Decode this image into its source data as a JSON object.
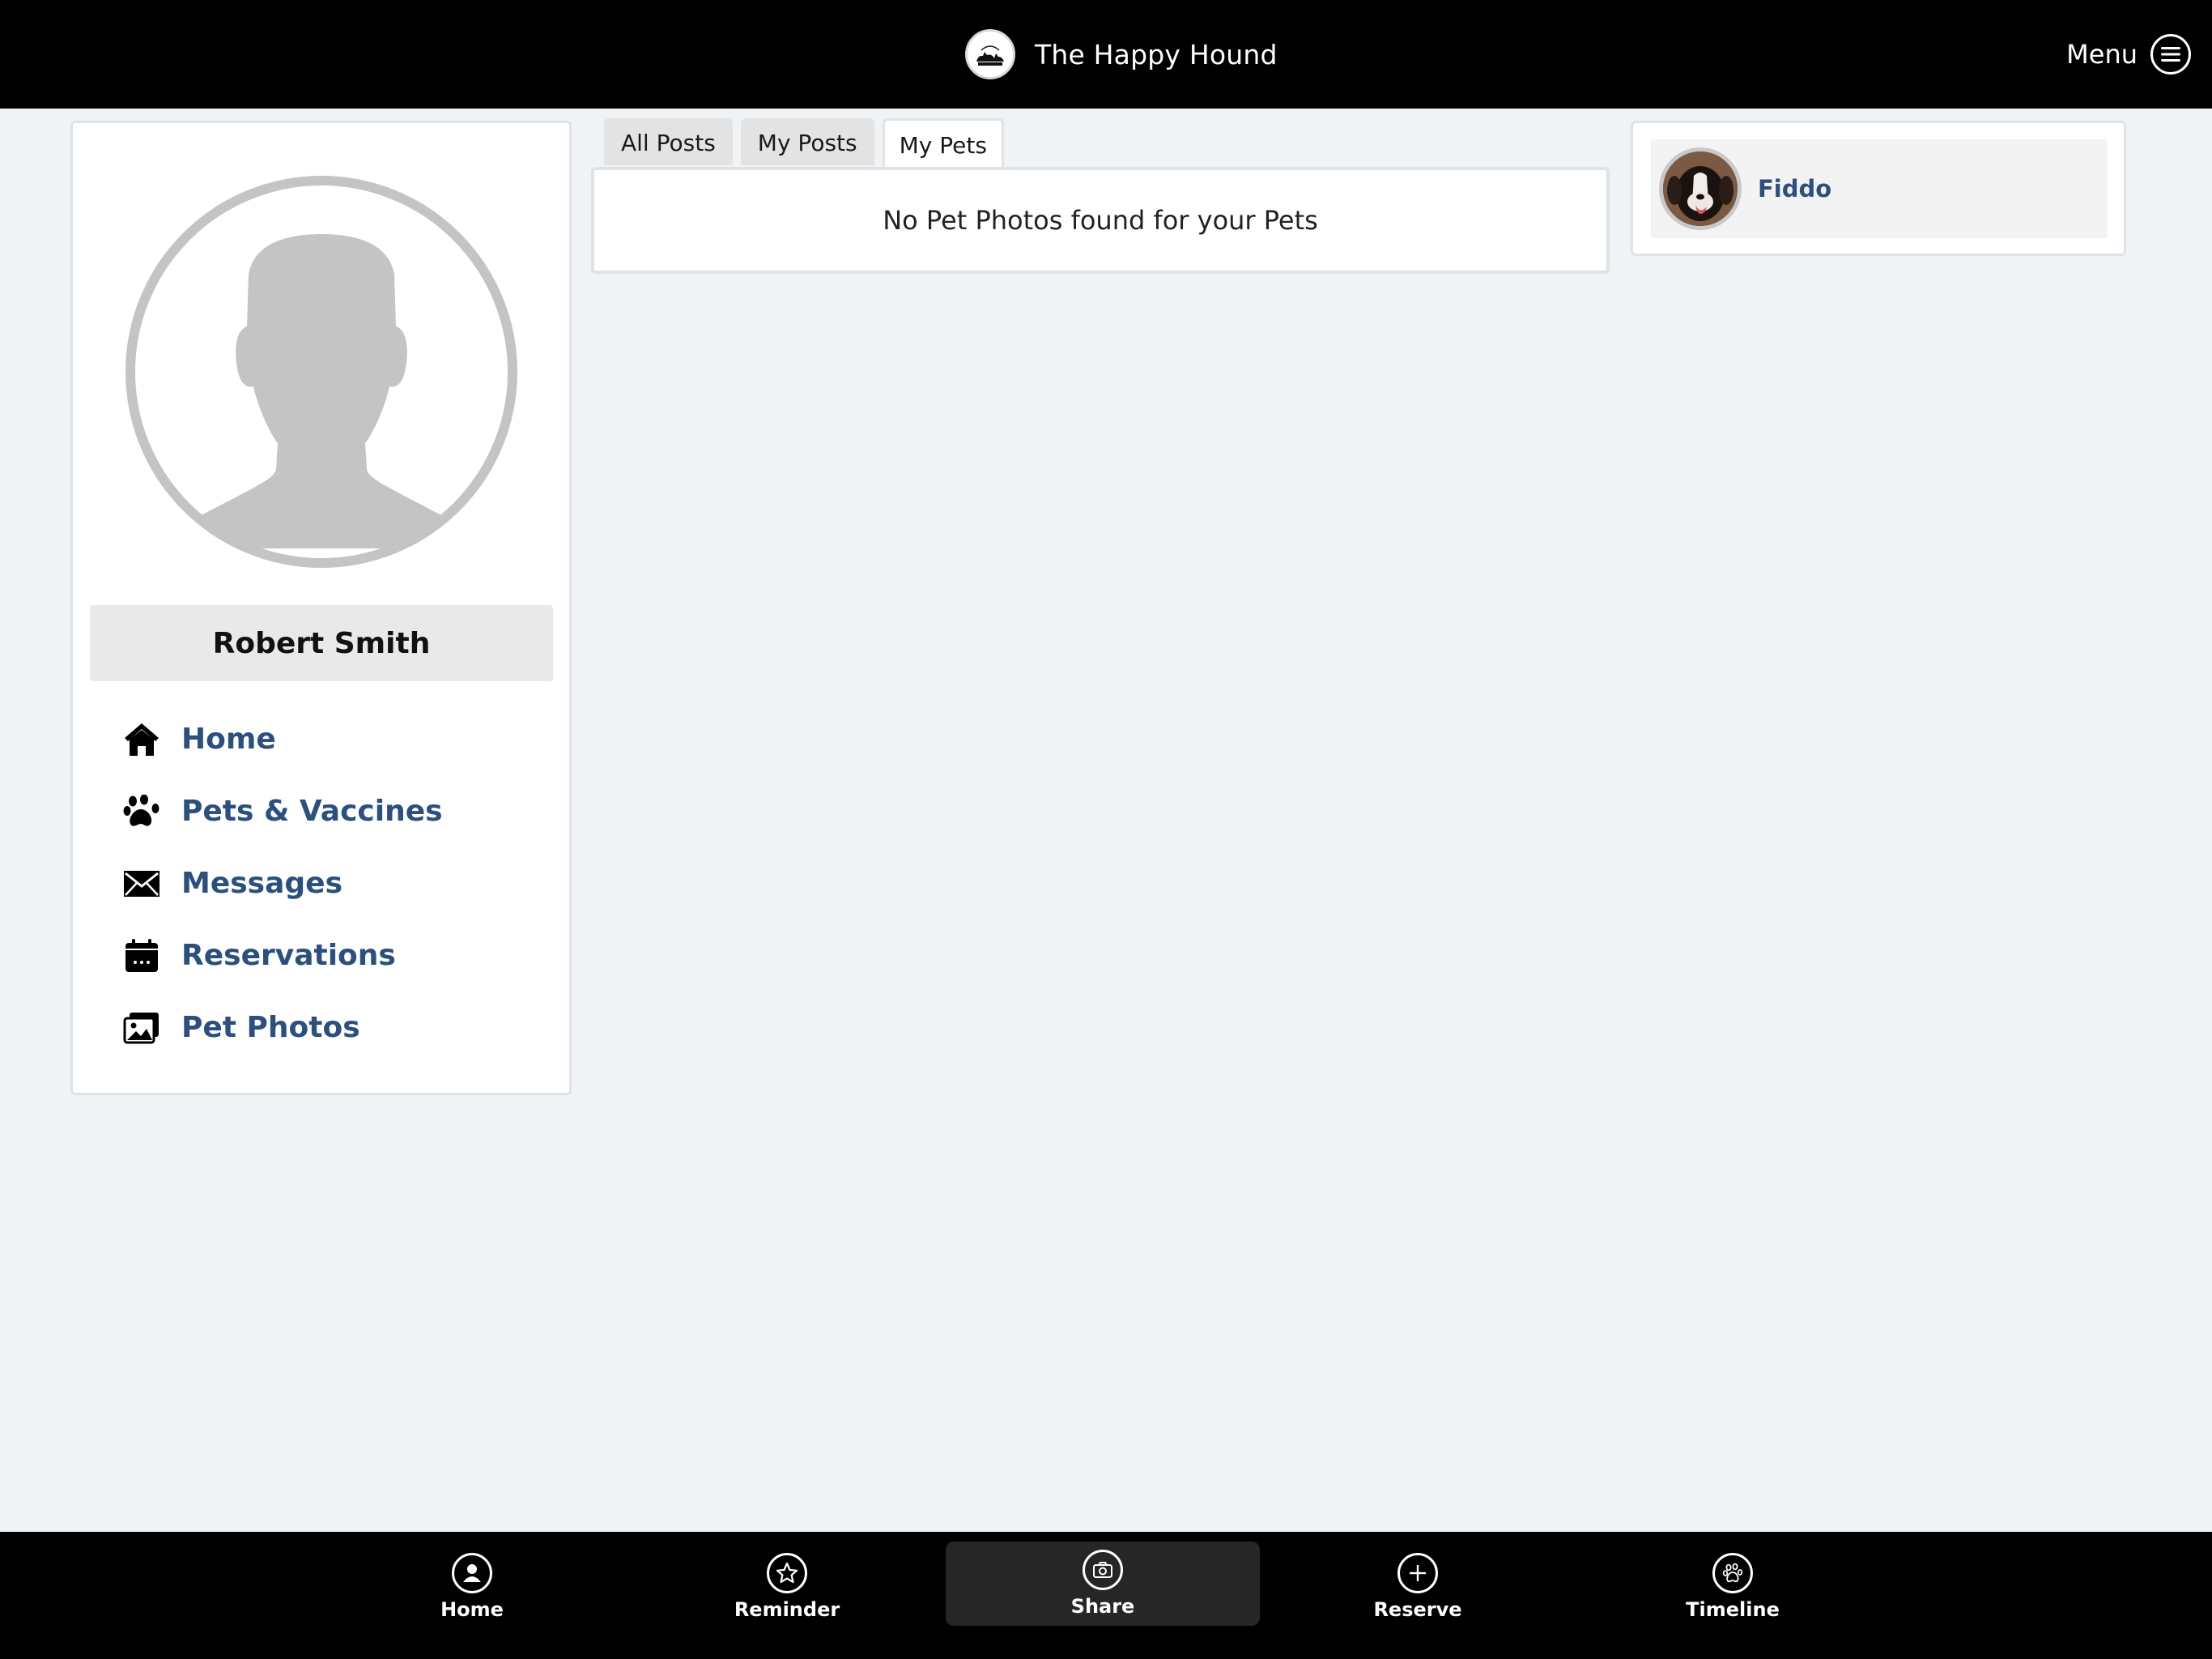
{
  "header": {
    "title": "The Happy Hound",
    "menu_label": "Menu",
    "logo_icon": "happy-hound-logo"
  },
  "profile": {
    "name": "Robert Smith",
    "avatar_icon": "default-user-silhouette"
  },
  "nav": {
    "items": [
      {
        "label": "Home",
        "icon": "house-icon"
      },
      {
        "label": "Pets & Vaccines",
        "icon": "paw-icon"
      },
      {
        "label": "Messages",
        "icon": "envelope-icon"
      },
      {
        "label": "Reservations",
        "icon": "calendar-icon"
      },
      {
        "label": "Pet Photos",
        "icon": "photos-icon"
      }
    ]
  },
  "tabs": [
    {
      "label": "All Posts",
      "active": false
    },
    {
      "label": "My Posts",
      "active": false
    },
    {
      "label": "My Pets",
      "active": true
    }
  ],
  "content": {
    "empty_message": "No Pet Photos found for your Pets"
  },
  "pets": [
    {
      "name": "Fiddo"
    }
  ],
  "bottom_nav": {
    "items": [
      {
        "label": "Home",
        "icon": "user-circle-icon",
        "active": false
      },
      {
        "label": "Reminder",
        "icon": "star-icon",
        "active": false
      },
      {
        "label": "Share",
        "icon": "camera-icon",
        "active": true
      },
      {
        "label": "Reserve",
        "icon": "plus-icon",
        "active": false
      },
      {
        "label": "Timeline",
        "icon": "paw-circle-icon",
        "active": false
      }
    ]
  },
  "colors": {
    "bar_background": "#000000",
    "page_background": "#eff3f6",
    "link_color": "#2b4f7e"
  }
}
